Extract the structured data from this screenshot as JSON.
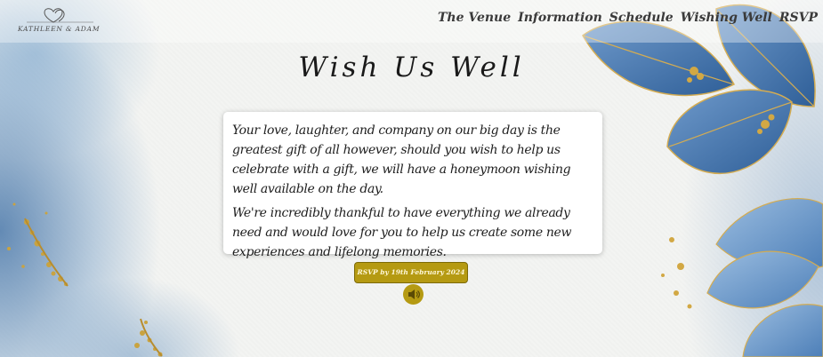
{
  "header": {
    "logo_text": "KATHLEEN & ADAM",
    "nav": [
      {
        "label": "The Venue"
      },
      {
        "label": "Information"
      },
      {
        "label": "Schedule"
      },
      {
        "label": "Wishing Well"
      },
      {
        "label": "RSVP"
      }
    ]
  },
  "main": {
    "title": "Wish Us Well",
    "paragraphs": [
      "Your love, laughter, and company on our big day is the greatest gift of all however, should you wish to help us celebrate with a gift, we will have a honeymoon wishing well available on the day.",
      "We're incredibly thankful to have everything we already need and would love for you to help us create some new experiences and lifelong memories."
    ],
    "rsvp_button_label": "RSVP by 19th February 2024",
    "audio_icon": "speaker-icon"
  },
  "colors": {
    "accent_gold": "#b59a12",
    "leaf_blue": "#3f6fa8",
    "text": "#1e1e1e"
  }
}
